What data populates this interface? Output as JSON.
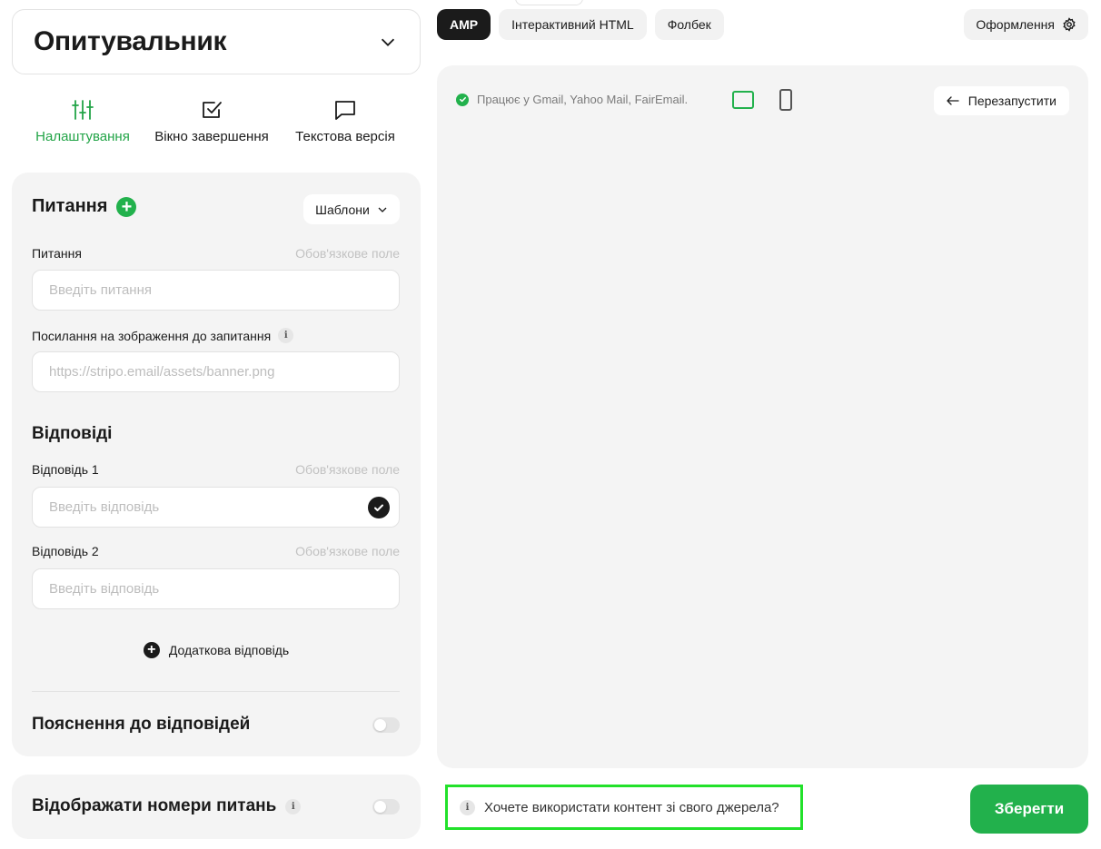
{
  "widget": {
    "title": "Опитувальник"
  },
  "side_tabs": [
    {
      "label": "Налаштування",
      "icon": "sliders-icon",
      "active": true
    },
    {
      "label": "Вікно завершення",
      "icon": "checkbox-icon",
      "active": false
    },
    {
      "label": "Текстова версія",
      "icon": "speech-bubble-icon",
      "active": false
    }
  ],
  "question": {
    "heading": "Питання",
    "templates_label": "Шаблони",
    "field_label": "Питання",
    "required_hint": "Обов'язкове поле",
    "field_placeholder": "Введіть питання",
    "image_label": "Посилання на зображення до запитання",
    "image_placeholder": "https://stripo.email/assets/banner.png"
  },
  "answers": {
    "heading": "Відповіді",
    "items": [
      {
        "label": "Відповідь 1",
        "required": "Обов'язкове поле",
        "placeholder": "Введіть відповідь",
        "correct": true
      },
      {
        "label": "Відповідь 2",
        "required": "Обов'язкове поле",
        "placeholder": "Введіть відповідь",
        "correct": false
      }
    ],
    "add_label": "Додаткова відповідь"
  },
  "explanations": {
    "label": "Пояснення до відповідей",
    "enabled": false
  },
  "show_numbers": {
    "label": "Відображати номери питань",
    "enabled": false
  },
  "format_tabs": [
    {
      "label": "AMP",
      "active": true
    },
    {
      "label": "Інтерактивний HTML",
      "active": false
    },
    {
      "label": "Фолбек",
      "active": false
    }
  ],
  "design_label": "Оформлення",
  "preview": {
    "works_text": "Працює у Gmail, Yahoo Mail, FairEmail.",
    "restart_label": "Перезапустити"
  },
  "own_source_text": "Хочете використати контент зі свого джерела?",
  "save_label": "Зберегти",
  "colors": {
    "accent": "#22b14c",
    "dark": "#1b1b1b",
    "panel": "#f4f4f4"
  }
}
